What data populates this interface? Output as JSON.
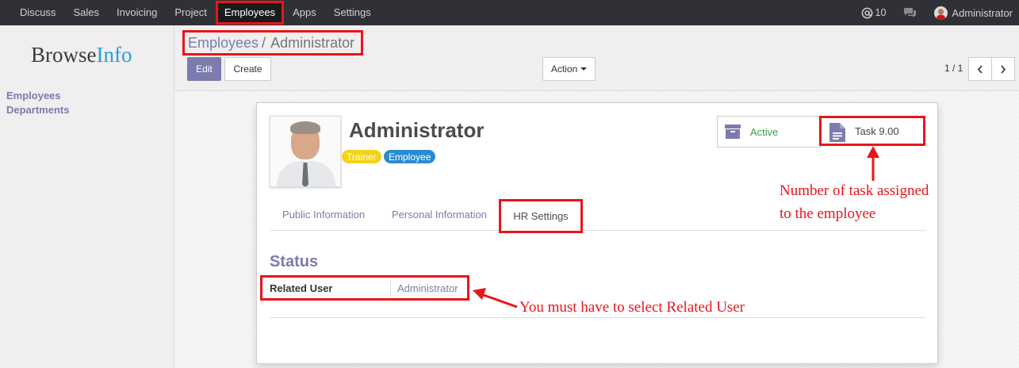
{
  "topbar": {
    "menu": [
      "Discuss",
      "Sales",
      "Invoicing",
      "Project",
      "Employees",
      "Apps",
      "Settings"
    ],
    "active_menu": "Employees",
    "messages_count": "10",
    "user_name": "Administrator"
  },
  "sidebar": {
    "logo_part1": "Browse",
    "logo_part2": "Info",
    "items": [
      {
        "label": "Employees"
      },
      {
        "label": "Departments"
      }
    ]
  },
  "control_panel": {
    "breadcrumb_parent": "Employees",
    "breadcrumb_separator": "/",
    "breadcrumb_current": "Administrator",
    "edit_label": "Edit",
    "create_label": "Create",
    "action_label": "Action",
    "pager_text": "1 / 1"
  },
  "employee": {
    "name": "Administrator",
    "tags": [
      "Trainer",
      "Employee"
    ],
    "stat_active_label": "Active",
    "task_label": "Task 9.00"
  },
  "tabs": [
    "Public Information",
    "Personal Information",
    "HR Settings"
  ],
  "hr_settings": {
    "section_title": "Status",
    "related_user_label": "Related User",
    "related_user_value": "Administrator"
  },
  "annotations": {
    "task_note_line1": "Number of task assigned",
    "task_note_line2": "to the employee",
    "user_note": "You must have to select Related User",
    "color": "#e8151b"
  },
  "colors": {
    "accent": "#7c7bad",
    "navbar": "#2f3136",
    "highlight": "#e8151b"
  }
}
